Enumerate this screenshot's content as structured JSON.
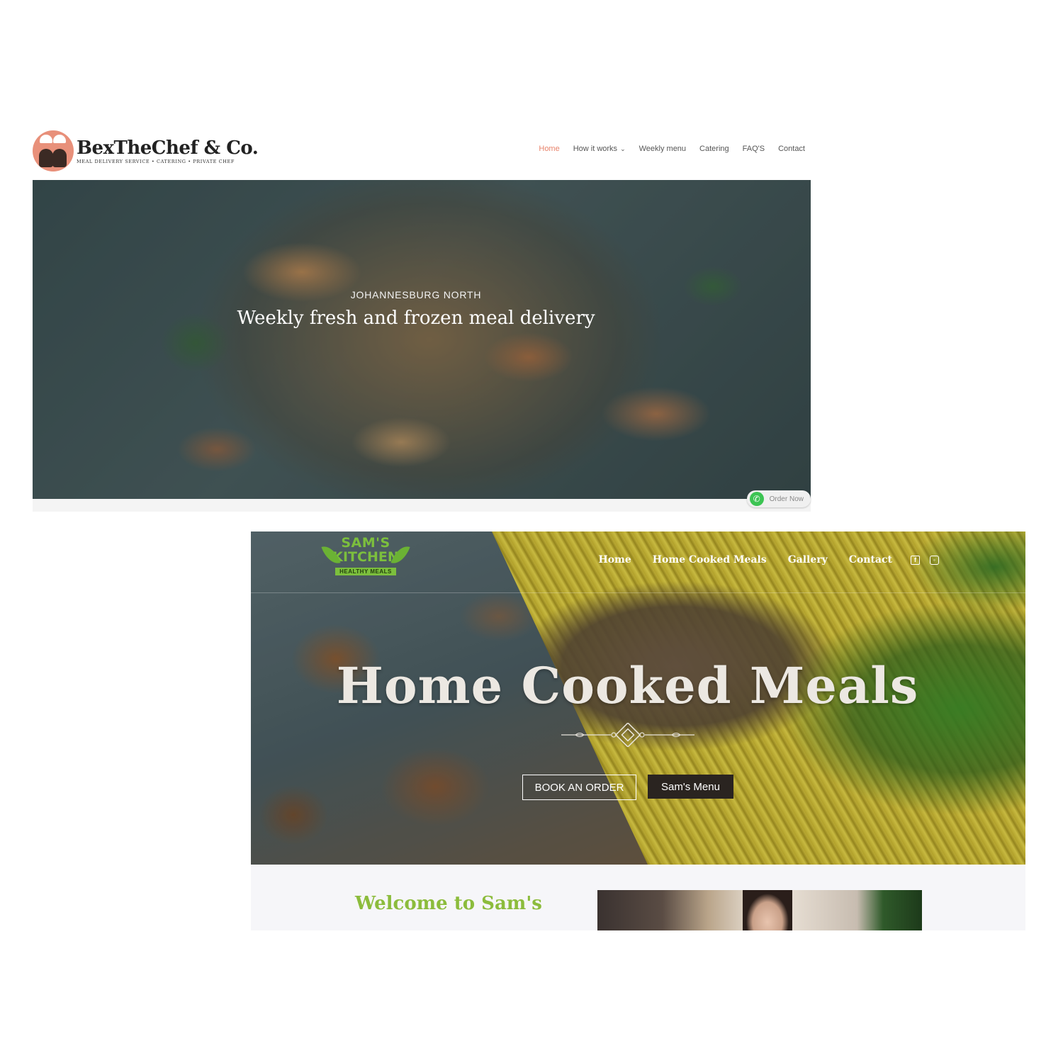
{
  "bex": {
    "logo_name": "BexTheChef & Co.",
    "logo_tagline": "MEAL DELIVERY SERVICE • CATERING • PRIVATE CHEF",
    "nav": [
      {
        "label": "Home",
        "active": true
      },
      {
        "label": "How it works",
        "has_dropdown": true
      },
      {
        "label": "Weekly menu"
      },
      {
        "label": "Catering"
      },
      {
        "label": "FAQ'S"
      },
      {
        "label": "Contact"
      }
    ],
    "hero_subtitle": "JOHANNESBURG NORTH",
    "hero_title": "Weekly fresh and frozen meal delivery",
    "order_button": "Order Now",
    "accent_color": "#e8836b",
    "whatsapp_color": "#3cc453"
  },
  "sams": {
    "logo_line1": "SAM'S",
    "logo_line2": "KITCHEN",
    "logo_line3": "HEALTHY MEALS",
    "nav": [
      {
        "label": "Home"
      },
      {
        "label": "Home Cooked Meals"
      },
      {
        "label": "Gallery"
      },
      {
        "label": "Contact"
      }
    ],
    "social_icons": [
      "facebook-icon",
      "instagram-icon"
    ],
    "hero_title": "Home Cooked Meals",
    "buttons": {
      "book": "BOOK AN ORDER",
      "menu": "Sam's Menu"
    },
    "welcome_heading": "Welcome to Sam's",
    "brand_green": "#7cbf3d"
  }
}
